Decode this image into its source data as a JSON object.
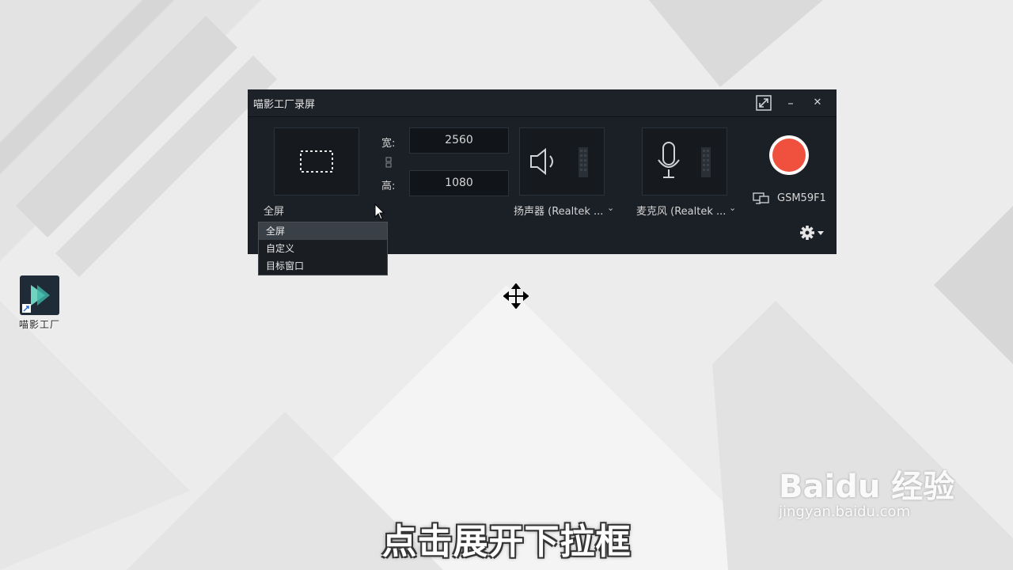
{
  "desktop": {
    "app_icon_label": "喵影工厂"
  },
  "window": {
    "title": "喵影工厂录屏",
    "buttons": {
      "expand": "⤢",
      "minimize": "–",
      "close": "✕"
    }
  },
  "capture": {
    "mode_label": "全屏",
    "width_label": "宽:",
    "height_label": "高:",
    "width_value": "2560",
    "height_value": "1080"
  },
  "audio": {
    "speaker_label": "扬声器 (Realtek ...",
    "mic_label": "麦克风 (Realtek ..."
  },
  "monitor": {
    "name": "GSM59F1"
  },
  "dropdown": {
    "options": [
      "全屏",
      "自定义",
      "目标窗口"
    ],
    "selected_index": 0
  },
  "icons": {
    "record": "record-button-icon",
    "settings": "gear-icon",
    "speaker": "speaker-icon",
    "microphone": "microphone-icon",
    "monitor": "monitor-icon",
    "cursor": "move-cursor-icon"
  },
  "colors": {
    "record": "#f0513e",
    "window_bg": "#1b1f26"
  },
  "subtitle": "点击展开下拉框",
  "watermark": {
    "brand": "Baidu 经验",
    "url": "jingyan.baidu.com"
  }
}
